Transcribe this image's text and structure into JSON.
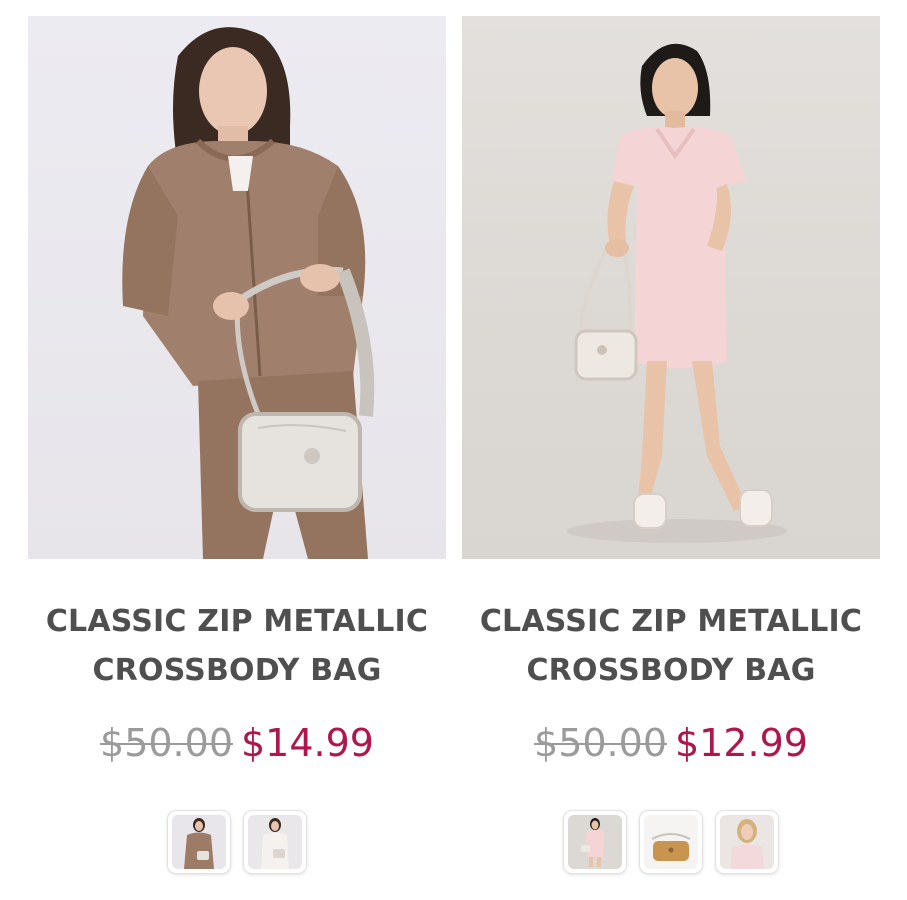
{
  "products": [
    {
      "title": "CLASSIC ZIP METALLIC\nCROSSBODY BAG",
      "old_price": "$50.00",
      "sale_price": "$14.99",
      "image": "model-brown-velour-tracksuit-with-bag",
      "swatches": [
        {
          "image": "brown-velour-model-thumb"
        },
        {
          "image": "white-outfit-model-thumb"
        }
      ]
    },
    {
      "title": "CLASSIC ZIP METALLIC\nCROSSBODY BAG",
      "old_price": "$50.00",
      "sale_price": "$12.99",
      "image": "model-pink-polo-dress-with-bag",
      "swatches": [
        {
          "image": "pink-dress-model-thumb"
        },
        {
          "image": "tan-bag-thumb"
        },
        {
          "image": "pink-top-model-thumb"
        }
      ]
    }
  ],
  "colors": {
    "title": "#4f4f4f",
    "old_price": "#9b9b9b",
    "sale_price": "#b0154c"
  }
}
